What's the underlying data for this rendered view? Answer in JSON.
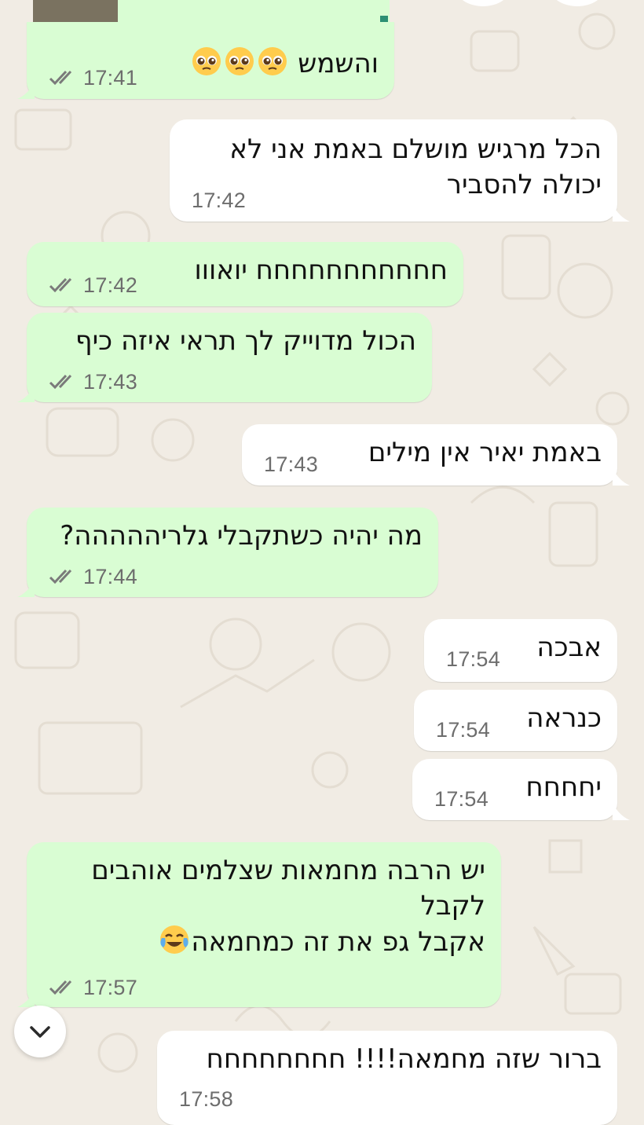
{
  "messages": [
    {
      "id": "m1",
      "dir": "out",
      "text": "והשמש",
      "emoji": [
        "pleading-face",
        "pleading-face",
        "pleading-face"
      ],
      "time": "17:41"
    },
    {
      "id": "m2",
      "dir": "in",
      "text": "הכל מרגיש מושלם באמת אני לא\nיכולה להסביר",
      "time": "17:42"
    },
    {
      "id": "m3",
      "dir": "out",
      "text": "חחחחחחחחחחח יואווו",
      "time": "17:42"
    },
    {
      "id": "m4",
      "dir": "out",
      "text": "הכול מדוייק לך תראי איזה כיף",
      "time": "17:43"
    },
    {
      "id": "m5",
      "dir": "in",
      "text": "באמת יאיר אין מילים",
      "time": "17:43"
    },
    {
      "id": "m6",
      "dir": "out",
      "text": "מה יהיה כשתקבלי גלריההההה?",
      "time": "17:44"
    },
    {
      "id": "m7",
      "dir": "in",
      "text": "אבכה",
      "time": "17:54"
    },
    {
      "id": "m8",
      "dir": "in",
      "text": "כנראה",
      "time": "17:54"
    },
    {
      "id": "m9",
      "dir": "in",
      "text": "יחחחח",
      "time": "17:54"
    },
    {
      "id": "m10",
      "dir": "out",
      "text": "יש הרבה מחמאות שצלמים אוהבים\nלקבל\nאקבל גפ את זה כמחמאה",
      "emoji": [
        "face-with-tears-of-joy"
      ],
      "time": "17:57"
    },
    {
      "id": "m11",
      "dir": "in",
      "text": "ברור שזה מחמאה!!!! חחחחחחחח",
      "time": "17:58"
    }
  ],
  "colors": {
    "outgoing_bubble": "#d9fdd3",
    "incoming_bubble": "#ffffff",
    "read_ticks": "#7a7a7a",
    "wallpaper": "#f1ece4"
  },
  "icons": {
    "read_receipt": "double-check-icon",
    "scroll_down": "chevron-down-icon"
  }
}
